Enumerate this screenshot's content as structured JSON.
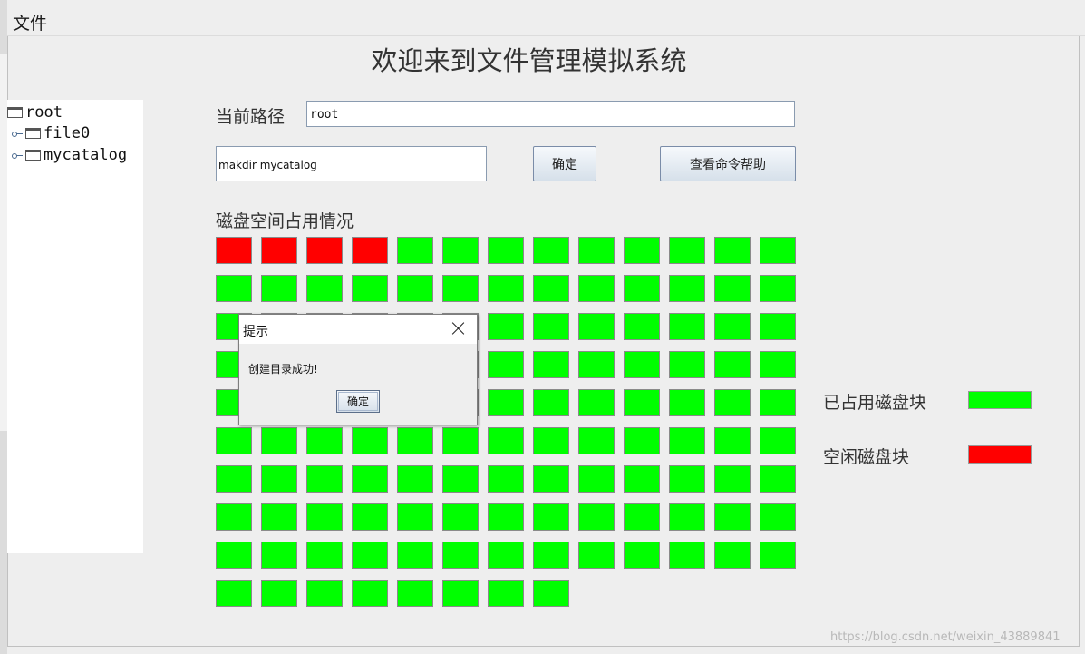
{
  "menu": {
    "file_label": "文件"
  },
  "app": {
    "title": "欢迎来到文件管理模拟系统"
  },
  "tree": {
    "root": "root",
    "children": [
      "file0",
      "mycatalog"
    ]
  },
  "path": {
    "label": "当前路径",
    "value": "root"
  },
  "command": {
    "value": "makdir mycatalog",
    "ok_label": "确定",
    "help_label": "查看命令帮助"
  },
  "disk": {
    "heading": "磁盘空间占用情况",
    "columns": 13,
    "total_blocks": 125,
    "red_blocks": [
      0,
      1,
      2,
      3
    ],
    "used_color": "#00ff00",
    "free_color": "#ff0000"
  },
  "legend": {
    "used_label": "已占用磁盘块",
    "free_label": "空闲磁盘块",
    "used_color": "#00ff00",
    "free_color": "#ff0000"
  },
  "dialog": {
    "title": "提示",
    "message": "创建目录成功!",
    "ok_label": "确定"
  },
  "watermark": "https://blog.csdn.net/weixin_43889841"
}
